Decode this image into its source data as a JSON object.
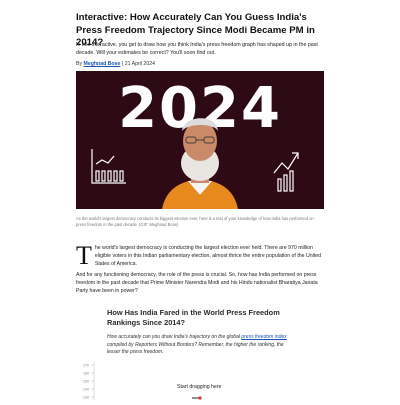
{
  "article": {
    "headline": "Interactive: How Accurately Can You Guess India's Press Freedom Trajectory Since Modi Became PM in 2014?",
    "deck": "In this interactive, you get to draw how you think India's press freedom graph has shaped up in the past decade. Will your estimates be correct? You'll soon find out.",
    "byline": {
      "prefix": "By",
      "author": "Meghnad Bose",
      "separator": "|",
      "date": "21 April 2024"
    },
    "hero": {
      "year_text": "2024"
    },
    "caption": "As the world's largest democracy conducts its biggest election ever, here is a test of your knowledge of how India has performed on press freedom in the past decade. (GIF: Meghnad Bose)",
    "paragraph1": {
      "dropcap": "T",
      "text": "he world's largest democracy is conducting the largest election ever held. There are 970 million eligible voters in this Indian parliamentary election, almost thrice the entire population of the United States of America."
    },
    "paragraph2": "And for any functioning democracy, the role of the press is crucial. So, how has India performed on press freedom in the past decade that Prime Minister Narendra Modi and his Hindu nationalist Bharatiya Janata Party have been in power?"
  },
  "interactive": {
    "title": "How Has India Fared in the World Press Freedom Rankings Since 2014?",
    "instructions_before_link": "How accurately can you draw India's trajectory on the global ",
    "instructions_link": "press freedom index",
    "instructions_after_link": " compiled by Reporters Without Borders? Remember, the higher the ranking, the lesser the press freedom.",
    "drag_hint": "Start dragging here",
    "y_ticks": [
      "170",
      "160",
      "150",
      "140",
      "130"
    ]
  },
  "colors": {
    "link": "#1a56b3",
    "hero_bg": "#2e0a14",
    "marker": "#d9342b"
  }
}
